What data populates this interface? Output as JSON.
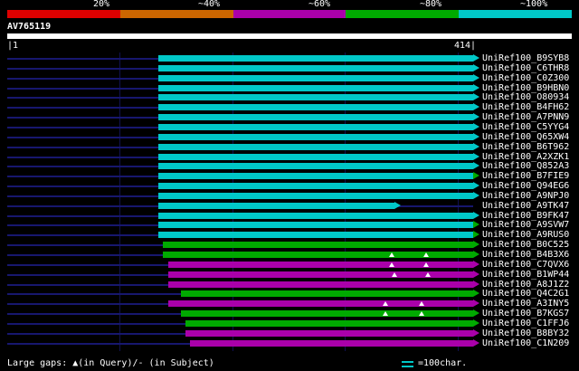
{
  "chart_data": {
    "type": "bar",
    "title": "AV765119",
    "query": {
      "name": "AV765119",
      "length": 414,
      "start_label": "|1",
      "end_label": "414|"
    },
    "identity_key": [
      {
        "label": "20%",
        "color": "#dd0000"
      },
      {
        "label": "~40%",
        "color": "#cc6600"
      },
      {
        "label": "~60%",
        "color": "#aa00aa"
      },
      {
        "label": "~80%",
        "color": "#00aa00"
      },
      {
        "label": "~100%",
        "color": "#00c8c8"
      }
    ],
    "palette": {
      "cyan": "#00c8c8",
      "green": "#00aa00",
      "purple": "#aa00aa"
    },
    "hits": [
      {
        "id": "UniRef100_B9SYB8",
        "start": 134,
        "end": 414,
        "color": "cyan"
      },
      {
        "id": "UniRef100_C6THR8",
        "start": 134,
        "end": 414,
        "color": "cyan"
      },
      {
        "id": "UniRef100_C0Z300",
        "start": 134,
        "end": 414,
        "color": "cyan"
      },
      {
        "id": "UniRef100_B9HBN0",
        "start": 134,
        "end": 414,
        "color": "cyan"
      },
      {
        "id": "UniRef100_O80934",
        "start": 134,
        "end": 414,
        "color": "cyan"
      },
      {
        "id": "UniRef100_B4FH62",
        "start": 134,
        "end": 414,
        "color": "cyan"
      },
      {
        "id": "UniRef100_A7PNN9",
        "start": 134,
        "end": 414,
        "color": "cyan"
      },
      {
        "id": "UniRef100_C5YYG4",
        "start": 134,
        "end": 414,
        "color": "cyan"
      },
      {
        "id": "UniRef100_Q65XW4",
        "start": 134,
        "end": 414,
        "color": "cyan"
      },
      {
        "id": "UniRef100_B6T962",
        "start": 134,
        "end": 414,
        "color": "cyan"
      },
      {
        "id": "UniRef100_A2XZK1",
        "start": 134,
        "end": 414,
        "color": "cyan"
      },
      {
        "id": "UniRef100_Q852A3",
        "start": 134,
        "end": 414,
        "color": "cyan"
      },
      {
        "id": "UniRef100_B7FIE9",
        "start": 134,
        "end": 414,
        "color": "cyan",
        "arrow": "green"
      },
      {
        "id": "UniRef100_Q94EG6",
        "start": 134,
        "end": 414,
        "color": "cyan"
      },
      {
        "id": "UniRef100_A9NPJ0",
        "start": 134,
        "end": 414,
        "color": "cyan"
      },
      {
        "id": "UniRef100_A9TK47",
        "start": 134,
        "end": 344,
        "color": "cyan"
      },
      {
        "id": "UniRef100_B9FK47",
        "start": 134,
        "end": 414,
        "color": "cyan"
      },
      {
        "id": "UniRef100_A9SVW7",
        "start": 134,
        "end": 414,
        "color": "cyan",
        "arrow": "green"
      },
      {
        "id": "UniRef100_A9RUS0",
        "start": 134,
        "end": 414,
        "color": "cyan",
        "arrow": "green"
      },
      {
        "id": "UniRef100_B0C525",
        "start": 138,
        "end": 414,
        "color": "green"
      },
      {
        "id": "UniRef100_B4B3X6",
        "start": 138,
        "end": 414,
        "color": "green",
        "query_gaps": [
          342,
          372
        ]
      },
      {
        "id": "UniRef100_C7QVX6",
        "start": 143,
        "end": 414,
        "color": "purple",
        "query_gaps": [
          342,
          372
        ]
      },
      {
        "id": "UniRef100_B1WP44",
        "start": 143,
        "end": 414,
        "color": "purple",
        "query_gaps": [
          344,
          374
        ]
      },
      {
        "id": "UniRef100_A8J1Z2",
        "start": 143,
        "end": 414,
        "color": "purple"
      },
      {
        "id": "UniRef100_Q4C2G1",
        "start": 154,
        "end": 414,
        "color": "green"
      },
      {
        "id": "UniRef100_A3INY5",
        "start": 143,
        "end": 414,
        "color": "purple",
        "query_gaps": [
          336,
          368
        ]
      },
      {
        "id": "UniRef100_B7KGS7",
        "start": 154,
        "end": 414,
        "color": "green",
        "query_gaps": [
          336,
          368
        ]
      },
      {
        "id": "UniRef100_C1FFJ6",
        "start": 158,
        "end": 414,
        "color": "green"
      },
      {
        "id": "UniRef100_B8BY32",
        "start": 158,
        "end": 414,
        "color": "purple"
      },
      {
        "id": "UniRef100_C1N209",
        "start": 162,
        "end": 414,
        "color": "purple"
      }
    ],
    "gridline_positions_chars": [
      100,
      200,
      300,
      400
    ]
  },
  "footer": {
    "gaps_legend": "Large gaps: ▲(in Query)/- (in Subject)",
    "scale_label": "=100char.",
    "scale_color": "#00c8c8"
  }
}
